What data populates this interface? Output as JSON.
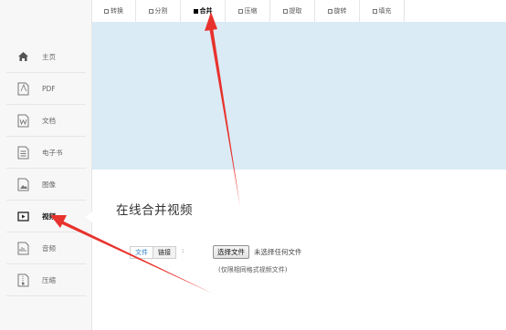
{
  "tabs": [
    {
      "label": "转换",
      "active": false
    },
    {
      "label": "分割",
      "active": false
    },
    {
      "label": "合并",
      "active": true
    },
    {
      "label": "压缩",
      "active": false
    },
    {
      "label": "提取",
      "active": false
    },
    {
      "label": "旋转",
      "active": false
    },
    {
      "label": "填充",
      "active": false
    }
  ],
  "sidebar": {
    "items": [
      {
        "label": "主页",
        "icon": "home-icon"
      },
      {
        "label": "PDF",
        "icon": "pdf-file-icon"
      },
      {
        "label": "文档",
        "icon": "word-document-icon"
      },
      {
        "label": "电子书",
        "icon": "ebook-icon"
      },
      {
        "label": "图像",
        "icon": "image-icon"
      },
      {
        "label": "视频",
        "icon": "video-icon",
        "active": true
      },
      {
        "label": "音频",
        "icon": "audio-icon"
      },
      {
        "label": "压缩",
        "icon": "archive-icon"
      }
    ]
  },
  "main": {
    "title": "在线合并视频",
    "mode": {
      "file": "文件",
      "link": "链接",
      "colon": ":"
    },
    "choose_file_label": "选择文件",
    "file_status": "未选择任何文件",
    "hint": "(仅限相同格式视频文件)"
  },
  "colors": {
    "banner": "#daebf6",
    "sidebar_bg": "#f7f7f7",
    "arrow": "#e8322d",
    "link": "#2a7fc8"
  }
}
